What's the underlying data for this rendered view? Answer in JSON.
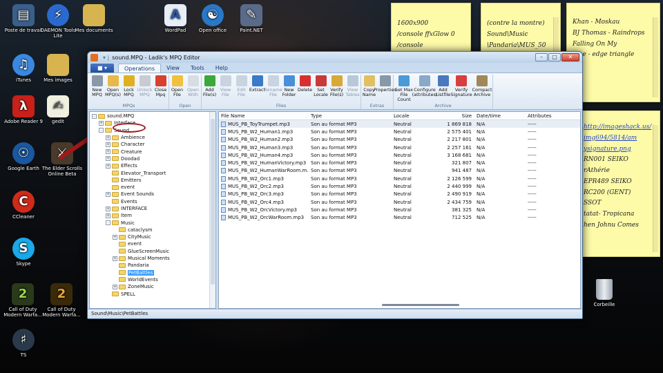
{
  "desktop": {
    "icons": [
      {
        "label": "Poste de travail"
      },
      {
        "label": "DAEMON Tools Lite"
      },
      {
        "label": "Mes documents"
      },
      {
        "label": "WordPad"
      },
      {
        "label": "Open office"
      },
      {
        "label": "Paint.NET"
      },
      {
        "label": "iTunes"
      },
      {
        "label": "Mes images"
      },
      {
        "label": "Adobe Reader 9"
      },
      {
        "label": "gedit"
      },
      {
        "label": "Google Earth"
      },
      {
        "label": "The Elder Scrolls Online Beta"
      },
      {
        "label": "CCleaner"
      },
      {
        "label": "Skype"
      },
      {
        "label": "Call of Duty Modern Warfa..."
      },
      {
        "label": "Call of Duty Modern Warfa..."
      },
      {
        "label": "TS"
      },
      {
        "label": "Corbeille"
      }
    ]
  },
  "notes": [
    {
      "lines": [
        "1600x900",
        "/console ffxGlow 0",
        "/console"
      ]
    },
    {
      "lines": [
        "(contre la montre)",
        "Sound\\Music",
        "\\Pandaria\\MUS_50"
      ]
    },
    {
      "lines": [
        "Khan - Moskau",
        "",
        "BJ Thomas - Raindrops",
        "Falling On My",
        "",
        "ume - edge triangle",
        "x"
      ]
    },
    {
      "lines": [
        "http://imageshack.us/",
        "img694/5814/am",
        "ysignature.png",
        "",
        "RN001 SEIKO",
        "rAthérie",
        "EPR489 SEIKO",
        "RC200 (GENT)",
        "SSOT",
        "",
        "tatat- Tropicana",
        "hen Johnu Comes"
      ]
    }
  ],
  "window": {
    "title": "sound.MPQ - Ladik's MPQ Editor",
    "menu": {
      "app_button": "■ ▾",
      "tabs": [
        "Operations",
        "View",
        "Tools",
        "Help"
      ]
    },
    "ribbon": {
      "groups": [
        {
          "name": "MPQs",
          "buttons": [
            {
              "label": "New MPQ",
              "dim": false,
              "color": "#8a98a8"
            },
            {
              "label": "Open MPQ(s)",
              "dim": false,
              "color": "#e8b84a"
            },
            {
              "label": "Lock MPQ",
              "dim": false,
              "color": "#e0b020"
            },
            {
              "label": "Unlock MPQ",
              "dim": true,
              "color": "#c8ccd2"
            },
            {
              "label": "Close Mpq",
              "dim": false,
              "color": "#d84030"
            }
          ]
        },
        {
          "name": "Open",
          "buttons": [
            {
              "label": "Open File",
              "dim": false,
              "color": "#f0c040"
            },
            {
              "label": "Open With",
              "dim": true,
              "color": "#d8dde4"
            }
          ]
        },
        {
          "name": "Files",
          "buttons": [
            {
              "label": "Add File(s)",
              "dim": false,
              "color": "#3aa83a"
            },
            {
              "label": "View File",
              "dim": true,
              "color": "#c8d4e0"
            },
            {
              "label": "Edit File",
              "dim": true,
              "color": "#c8d4e0"
            },
            {
              "label": "Extract",
              "dim": false,
              "color": "#3a7ac8"
            },
            {
              "label": "Rename File",
              "dim": true,
              "color": "#c8d4e0"
            },
            {
              "label": "New Folder",
              "dim": false,
              "color": "#4a90d8"
            },
            {
              "label": "Delete",
              "dim": false,
              "color": "#d83030"
            },
            {
              "label": "Set Locale",
              "dim": false,
              "color": "#c83a3a"
            },
            {
              "label": "Verify File(s)",
              "dim": false,
              "color": "#d8a838"
            },
            {
              "label": "View Tables",
              "dim": true,
              "color": "#b8c8d8"
            }
          ]
        },
        {
          "name": "Extras",
          "buttons": [
            {
              "label": "Copy Name",
              "dim": false,
              "color": "#e0c060"
            },
            {
              "label": "Properties",
              "dim": false,
              "color": "#8898a8"
            }
          ]
        },
        {
          "name": "Archive",
          "buttons": [
            {
              "label": "Set Max File Count",
              "dim": false,
              "color": "#4a9ad8"
            },
            {
              "label": "Configure (attributes)",
              "dim": false,
              "color": "#8aa8c8"
            },
            {
              "label": "Add Listfile",
              "dim": false,
              "color": "#4a78c0"
            },
            {
              "label": "Verify Signature",
              "dim": false,
              "color": "#d84040"
            },
            {
              "label": "Compact Archive",
              "dim": false,
              "color": "#a08858"
            }
          ]
        }
      ]
    },
    "tree": [
      {
        "label": "sound.MPQ",
        "depth": 0,
        "expander": "-"
      },
      {
        "label": "Interface",
        "depth": 1,
        "expander": "+"
      },
      {
        "label": "Sound",
        "depth": 1,
        "expander": "-"
      },
      {
        "label": "Ambience",
        "depth": 2,
        "expander": "+"
      },
      {
        "label": "Character",
        "depth": 2,
        "expander": "+"
      },
      {
        "label": "Creature",
        "depth": 2,
        "expander": "+"
      },
      {
        "label": "Doodad",
        "depth": 2,
        "expander": "+"
      },
      {
        "label": "Effects",
        "depth": 2,
        "expander": "+"
      },
      {
        "label": "Elevator_Transport",
        "depth": 2,
        "expander": ""
      },
      {
        "label": "Emitters",
        "depth": 2,
        "expander": ""
      },
      {
        "label": "event",
        "depth": 2,
        "expander": ""
      },
      {
        "label": "Event Sounds",
        "depth": 2,
        "expander": "+"
      },
      {
        "label": "Events",
        "depth": 2,
        "expander": ""
      },
      {
        "label": "INTERFACE",
        "depth": 2,
        "expander": "+"
      },
      {
        "label": "Item",
        "depth": 2,
        "expander": "+"
      },
      {
        "label": "Music",
        "depth": 2,
        "expander": "-"
      },
      {
        "label": "cataclysm",
        "depth": 3,
        "expander": ""
      },
      {
        "label": "CityMusic",
        "depth": 3,
        "expander": "+"
      },
      {
        "label": "event",
        "depth": 3,
        "expander": ""
      },
      {
        "label": "GlueScreenMusic",
        "depth": 3,
        "expander": ""
      },
      {
        "label": "Musical Moments",
        "depth": 3,
        "expander": "+"
      },
      {
        "label": "Pandaria",
        "depth": 3,
        "expander": ""
      },
      {
        "label": "PetBattles",
        "depth": 3,
        "expander": "",
        "selected": true
      },
      {
        "label": "WorldEvents",
        "depth": 3,
        "expander": ""
      },
      {
        "label": "ZoneMusic",
        "depth": 3,
        "expander": "+"
      },
      {
        "label": "SPELL",
        "depth": 2,
        "expander": ""
      }
    ],
    "files": {
      "columns": [
        "File Name",
        "Type",
        "Locale",
        "Size",
        "Date/time",
        "Attributes"
      ],
      "rows": [
        [
          "MUS_PB_ToyTrumpet.mp3",
          "Son au format MP3",
          "Neutral",
          "1 869 818",
          "N/A",
          "-----"
        ],
        [
          "MUS_PB_W2_Human1.mp3",
          "Son au format MP3",
          "Neutral",
          "2 575 401",
          "N/A",
          "-----"
        ],
        [
          "MUS_PB_W2_Human2.mp3",
          "Son au format MP3",
          "Neutral",
          "2 217 801",
          "N/A",
          "-----"
        ],
        [
          "MUS_PB_W2_Human3.mp3",
          "Son au format MP3",
          "Neutral",
          "2 257 161",
          "N/A",
          "-----"
        ],
        [
          "MUS_PB_W2_Human4.mp3",
          "Son au format MP3",
          "Neutral",
          "3 168 681",
          "N/A",
          "-----"
        ],
        [
          "MUS_PB_W2_HumanVictory.mp3",
          "Son au format MP3",
          "Neutral",
          "321 807",
          "N/A",
          "-----"
        ],
        [
          "MUS_PB_W2_HumanWarRoom.m...",
          "Son au format MP3",
          "Neutral",
          "941 487",
          "N/A",
          "-----"
        ],
        [
          "MUS_PB_W2_Orc1.mp3",
          "Son au format MP3",
          "Neutral",
          "2 126 599",
          "N/A",
          "-----"
        ],
        [
          "MUS_PB_W2_Orc2.mp3",
          "Son au format MP3",
          "Neutral",
          "2 440 999",
          "N/A",
          "-----"
        ],
        [
          "MUS_PB_W2_Orc3.mp3",
          "Son au format MP3",
          "Neutral",
          "2 490 919",
          "N/A",
          "-----"
        ],
        [
          "MUS_PB_W2_Orc4.mp3",
          "Son au format MP3",
          "Neutral",
          "2 434 759",
          "N/A",
          "-----"
        ],
        [
          "MUS_PB_W2_OrcVictory.mp3",
          "Son au format MP3",
          "Neutral",
          "381 325",
          "N/A",
          "-----"
        ],
        [
          "MUS_PB_W2_OrcWarRoom.mp3",
          "Son au format MP3",
          "Neutral",
          "712 525",
          "N/A",
          "-----"
        ]
      ]
    },
    "status": "Sound\\Music\\PetBattles"
  },
  "colors": {
    "annotation_red": "#a01818",
    "selection_blue": "#3399ff",
    "note_yellow": "#fdfba8"
  }
}
